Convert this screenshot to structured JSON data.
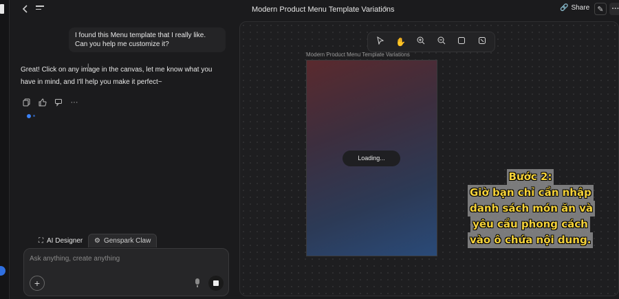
{
  "header": {
    "title": "Modern Product Menu Template Variations",
    "share_label": "Share",
    "icons": {
      "back": "back-arrow-icon",
      "menu": "menu-icon",
      "edit": "edit-icon",
      "more": "more-icon"
    }
  },
  "chat": {
    "user_message": "I found this Menu template that I really like. Can you help me customize it?",
    "assistant_message": "Great! Click on any image in the canvas, let me know what you have in mind, and I'll help you make it perfect~",
    "action_icons": [
      "copy-icon",
      "thumbs-up-icon",
      "thumbs-down-icon",
      "more-icon"
    ]
  },
  "modes": {
    "ai_designer": "AI Designer",
    "genspark_claw": "Genspark Claw"
  },
  "input": {
    "placeholder": "Ask anything, create anything",
    "value": ""
  },
  "canvas": {
    "tools": [
      "select-icon",
      "hand-icon",
      "zoom-in-icon",
      "zoom-out-icon",
      "fit-icon",
      "fullscreen-icon"
    ],
    "frame_label": "Modern Product Menu Template Variations",
    "loading_text": "Loading..."
  },
  "caption": {
    "lines": [
      "Bước 2:",
      "Giờ bạn chỉ cần nhập",
      "danh sách món ăn và",
      "yêu cầu phong cách",
      "vào ô chứa nội dung."
    ],
    "color": "#f5d23a"
  },
  "colors": {
    "accent": "#3b82f6",
    "background": "#1b1b1d"
  }
}
